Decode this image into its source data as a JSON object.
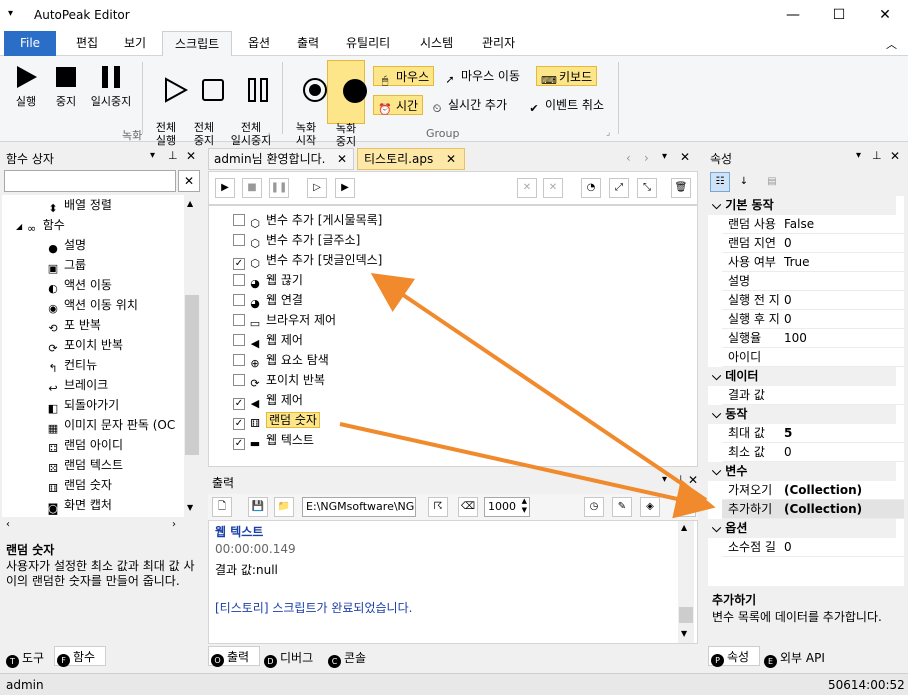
{
  "window": {
    "title": "AutoPeak Editor"
  },
  "ribbon_tabs": [
    "File",
    "편집",
    "보기",
    "스크립트",
    "옵션",
    "출력",
    "유틸리티",
    "시스템",
    "관리자"
  ],
  "ribbon": {
    "record": {
      "play": "실행",
      "stop": "중지",
      "pause": "일시중지",
      "play_all": "전체\n실행",
      "stop_all": "전체\n중지",
      "pause_all": "전체\n일시중지",
      "group": "녹화"
    },
    "group2": {
      "rec_start": "녹화\n시작",
      "rec_stop": "녹화\n중지",
      "mouse": "마우스",
      "mouse_move": "마우스 이동",
      "keyboard": "키보드",
      "time": "시간",
      "realtime_add": "실시간 추가",
      "event_cancel": "이벤트 취소",
      "group": "Group"
    }
  },
  "function_box": {
    "title": "함수 상자",
    "search_placeholder": "",
    "items": [
      {
        "label": "배열 정렬",
        "icon": "sort-icon",
        "level": 2
      },
      {
        "label": "함수",
        "icon": "function-icon",
        "level": 1
      },
      {
        "label": "설명",
        "icon": "comment-icon",
        "level": 2
      },
      {
        "label": "그룹",
        "icon": "group-icon",
        "level": 2
      },
      {
        "label": "액션 이동",
        "icon": "action-move-icon",
        "level": 2
      },
      {
        "label": "액션 이동 위치",
        "icon": "action-position-icon",
        "level": 2
      },
      {
        "label": "포 반복",
        "icon": "loop-icon",
        "level": 2
      },
      {
        "label": "포이치 반복",
        "icon": "foreach-icon",
        "level": 2
      },
      {
        "label": "컨티뉴",
        "icon": "continue-icon",
        "level": 2
      },
      {
        "label": "브레이크",
        "icon": "break-icon",
        "level": 2
      },
      {
        "label": "되돌아가기",
        "icon": "return-icon",
        "level": 2
      },
      {
        "label": "이미지 문자 판독 (OC",
        "icon": "ocr-icon",
        "level": 2
      },
      {
        "label": "랜덤 아이디",
        "icon": "random-id-icon",
        "level": 2
      },
      {
        "label": "랜덤 텍스트",
        "icon": "random-text-icon",
        "level": 2
      },
      {
        "label": "랜덤 숫자",
        "icon": "random-number-icon",
        "level": 2
      },
      {
        "label": "화면 캡처",
        "icon": "capture-icon",
        "level": 2
      }
    ],
    "desc_title": "랜덤 숫자",
    "desc_text": "사용자가 설정한 최소 값과 최대 값 사이의 랜덤한 숫자를 만들어 줍니다."
  },
  "doc_tabs": [
    {
      "label": "admin님 환영합니다."
    },
    {
      "label": "티스토리.aps"
    }
  ],
  "script_items": [
    {
      "label": "변수 추가 [게시물목록]",
      "checked": false
    },
    {
      "label": "변수 추가 [글주소]",
      "checked": false
    },
    {
      "label": "변수 추가 [댓글인덱스]",
      "checked": true
    },
    {
      "label": "웹 끊기",
      "checked": false
    },
    {
      "label": "웹 연결",
      "checked": false
    },
    {
      "label": "브라우저 제어",
      "checked": false
    },
    {
      "label": "웹 제어",
      "checked": false
    },
    {
      "label": "웹 요소 탐색",
      "checked": false
    },
    {
      "label": "포이치 반복",
      "checked": false
    },
    {
      "label": "웹 제어",
      "checked": true
    },
    {
      "label": "랜덤 숫자",
      "checked": true
    },
    {
      "label": "웹 텍스트",
      "checked": true
    }
  ],
  "output": {
    "title": "출력",
    "path": "E:\\NGMsoftware\\NG",
    "count": "1000",
    "lines": [
      {
        "text": "웹 텍스트",
        "color": "#1b3fa8",
        "bold": true
      },
      {
        "text": "00:00:00.149",
        "color": "#666666",
        "bold": false
      },
      {
        "text": "결과 값:null",
        "color": "#000000",
        "bold": false
      },
      {
        "text": "",
        "color": "#000000",
        "bold": false
      },
      {
        "text": "[티스토리] 스크립트가 완료되었습니다.",
        "color": "#1b3fa8",
        "bold": false
      }
    ]
  },
  "bottom_tabs": {
    "left": [
      "도구",
      "함수"
    ],
    "center": [
      "출력",
      "디버그",
      "콘솔"
    ],
    "right": [
      "속성",
      "외부 API"
    ]
  },
  "properties": {
    "title": "속성",
    "categories": [
      {
        "name": "기본 동작",
        "rows": [
          [
            "랜덤 사용",
            "False"
          ],
          [
            "랜덤 지연",
            "0"
          ],
          [
            "사용 여부",
            "True"
          ],
          [
            "설명",
            ""
          ],
          [
            "실행 전 지",
            "0"
          ],
          [
            "실행 후 지",
            "0"
          ],
          [
            "실행율",
            "100"
          ],
          [
            "아이디",
            ""
          ]
        ]
      },
      {
        "name": "데이터",
        "rows": [
          [
            "결과 값",
            ""
          ]
        ]
      },
      {
        "name": "동작",
        "rows": [
          [
            "최대 값",
            "5"
          ],
          [
            "최소 값",
            "0"
          ]
        ]
      },
      {
        "name": "변수",
        "rows": [
          [
            "가져오기",
            "(Collection)"
          ],
          [
            "추가하기",
            "(Collection)"
          ]
        ]
      },
      {
        "name": "옵션",
        "rows": [
          [
            "소수점 길",
            "0"
          ]
        ]
      }
    ],
    "desc_title": "추가하기",
    "desc_text": "변수 목록에 데이터를 추가합니다."
  },
  "status": {
    "user": "admin",
    "time": "50614:00:52"
  },
  "colors": {
    "accent": "#2b6ec8",
    "arrow": "#f08a2c",
    "highlight": "#fde68a"
  }
}
